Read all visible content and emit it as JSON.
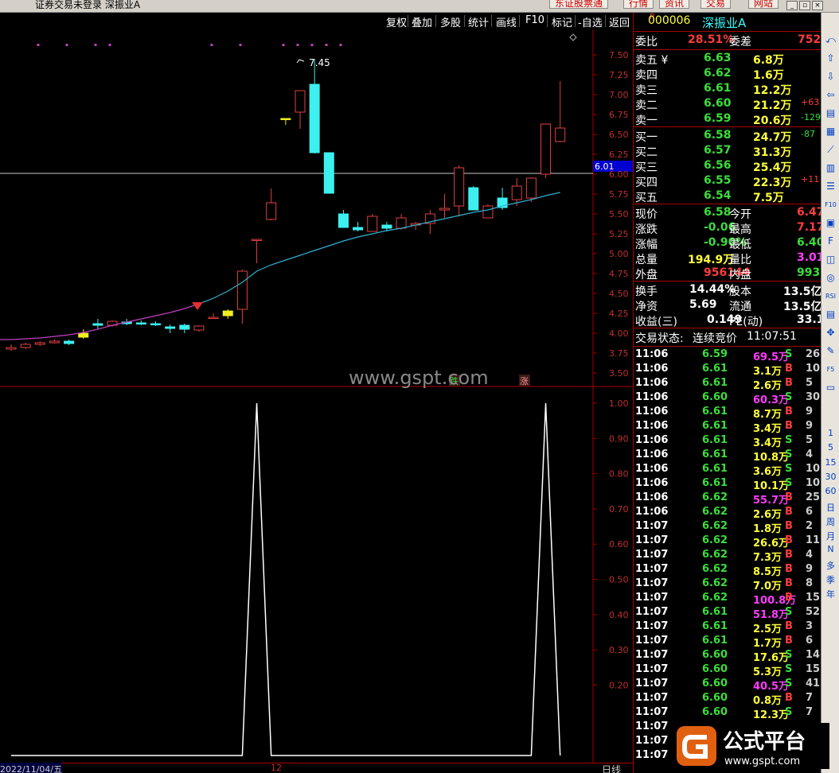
{
  "window": {
    "title": "证券交易未登录  深振业A",
    "top_buttons": [
      "东证股票通",
      "行情",
      "资讯",
      "交易",
      "网站"
    ],
    "win_controls": [
      "minimize-icon",
      "restore-icon",
      "close-icon"
    ]
  },
  "toolbar": {
    "items": [
      "复权",
      "叠加",
      "多股",
      "统计",
      "画线",
      "F10",
      "标记",
      "-自选",
      "返回"
    ]
  },
  "chart": {
    "price_label": "6.01",
    "high_label": "7.45",
    "watermark": "www.gspt.com",
    "down_tag": "跌",
    "up_tag": "涨",
    "date_label": "2022/11/04/五",
    "month_label": "12",
    "period_label": "日线",
    "colors": {
      "up": "#e04040",
      "down": "#3cf0f0",
      "ma": "#2fb0d0",
      "ma_old": "#c040c0",
      "yellow": "#f0f020",
      "indicator": "#ffffff"
    }
  },
  "chart_data": [
    {
      "type": "candlestick",
      "title": "",
      "ylim": [
        3.4,
        7.7
      ],
      "yticks": [
        "7.50",
        "7.25",
        "7.00",
        "6.75",
        "6.50",
        "6.25",
        "6.00",
        "5.75",
        "5.50",
        "5.25",
        "5.00",
        "4.75",
        "4.50",
        "4.25",
        "4.00",
        "3.75",
        "3.50"
      ],
      "ohlc": [
        [
          3.8,
          3.86,
          3.78,
          3.82
        ],
        [
          3.82,
          3.88,
          3.8,
          3.86
        ],
        [
          3.86,
          3.9,
          3.84,
          3.88
        ],
        [
          3.88,
          3.92,
          3.87,
          3.9
        ],
        [
          3.9,
          3.92,
          3.85,
          3.87
        ],
        [
          3.95,
          4.05,
          3.93,
          4.0
        ],
        [
          4.12,
          4.18,
          4.05,
          4.1
        ],
        [
          4.1,
          4.16,
          4.08,
          4.15
        ],
        [
          4.14,
          4.18,
          4.1,
          4.12
        ],
        [
          4.13,
          4.16,
          4.1,
          4.12
        ],
        [
          4.12,
          4.15,
          4.09,
          4.11
        ],
        [
          4.08,
          4.11,
          4.0,
          4.06
        ],
        [
          4.1,
          4.12,
          4.0,
          4.05
        ],
        [
          4.04,
          4.1,
          4.02,
          4.09
        ],
        [
          4.2,
          4.25,
          4.18,
          4.2
        ],
        [
          4.22,
          4.3,
          4.18,
          4.28
        ],
        [
          4.3,
          4.8,
          4.12,
          4.78
        ],
        [
          5.18,
          5.18,
          4.88,
          5.18
        ],
        [
          5.43,
          5.82,
          5.42,
          5.64
        ],
        [
          6.7,
          6.7,
          6.62,
          6.7
        ],
        [
          6.78,
          7.05,
          6.57,
          7.05
        ],
        [
          7.13,
          7.45,
          6.26,
          6.27
        ],
        [
          6.27,
          6.27,
          5.76,
          5.76
        ],
        [
          5.5,
          5.55,
          5.33,
          5.33
        ],
        [
          5.33,
          5.4,
          5.28,
          5.3
        ],
        [
          5.28,
          5.5,
          5.28,
          5.47
        ],
        [
          5.36,
          5.4,
          5.28,
          5.32
        ],
        [
          5.32,
          5.5,
          5.3,
          5.45
        ],
        [
          5.36,
          5.4,
          5.3,
          5.38
        ],
        [
          5.38,
          5.55,
          5.25,
          5.5
        ],
        [
          5.55,
          5.75,
          5.45,
          5.57
        ],
        [
          5.6,
          6.11,
          5.47,
          6.08
        ],
        [
          5.83,
          5.85,
          5.55,
          5.55
        ],
        [
          5.45,
          5.62,
          5.45,
          5.6
        ],
        [
          5.7,
          5.83,
          5.55,
          5.58
        ],
        [
          5.68,
          5.95,
          5.6,
          5.85
        ],
        [
          5.7,
          5.96,
          5.65,
          5.95
        ],
        [
          6.0,
          6.63,
          5.95,
          6.63
        ],
        [
          6.41,
          7.17,
          6.4,
          6.58
        ]
      ],
      "ma": [
        3.92,
        3.93,
        3.94,
        3.96,
        3.98,
        4.01,
        4.05,
        4.1,
        4.14,
        4.18,
        4.22,
        4.26,
        4.31,
        4.37,
        4.44,
        4.53,
        4.64,
        4.78,
        4.86,
        4.92,
        4.98,
        5.04,
        5.1,
        5.16,
        5.21,
        5.25,
        5.29,
        5.32,
        5.36,
        5.4,
        5.44,
        5.48,
        5.52,
        5.55,
        5.6,
        5.64,
        5.68,
        5.73,
        5.77
      ]
    },
    {
      "type": "line",
      "title": "",
      "ylim": [
        0.1,
        1.05
      ],
      "yticks": [
        "1.00",
        "0.90",
        "0.80",
        "0.70",
        "0.60",
        "0.50",
        "0.40",
        "0.30",
        "0.20"
      ],
      "values": [
        0,
        0,
        0,
        0,
        0,
        0,
        0,
        0,
        0,
        0,
        0,
        0,
        0,
        0,
        0,
        0,
        0,
        1,
        0,
        0,
        0,
        0,
        0,
        0,
        0,
        0,
        0,
        0,
        0,
        0,
        0,
        0,
        0,
        0,
        0,
        0,
        0,
        1,
        0
      ]
    }
  ],
  "quote": {
    "code_prefix": "R",
    "code": "000006",
    "name": "深振业A",
    "wei_bi_label": "委比",
    "wei_bi": "28.51%",
    "wei_cha_label": "委差",
    "wei_cha": "752",
    "asks": [
      {
        "label": "卖五",
        "mark": "¥",
        "price": "6.63",
        "vol": "6.8万",
        "chg": ""
      },
      {
        "label": "卖四",
        "mark": "",
        "price": "6.62",
        "vol": "1.6万",
        "chg": ""
      },
      {
        "label": "卖三",
        "mark": "",
        "price": "6.61",
        "vol": "12.2万",
        "chg": ""
      },
      {
        "label": "卖二",
        "mark": "",
        "price": "6.60",
        "vol": "21.2万",
        "chg": "+63"
      },
      {
        "label": "卖一",
        "mark": "",
        "price": "6.59",
        "vol": "20.6万",
        "chg": "-129"
      }
    ],
    "bids": [
      {
        "label": "买一",
        "price": "6.58",
        "vol": "24.7万",
        "chg": "-87"
      },
      {
        "label": "买二",
        "price": "6.57",
        "vol": "31.3万",
        "chg": ""
      },
      {
        "label": "买三",
        "price": "6.56",
        "vol": "25.4万",
        "chg": ""
      },
      {
        "label": "买四",
        "price": "6.55",
        "vol": "22.3万",
        "chg": "+11"
      },
      {
        "label": "买五",
        "price": "6.54",
        "vol": "7.5万",
        "chg": ""
      }
    ],
    "stats": [
      {
        "l1": "现价",
        "v1": "6.58",
        "l2": "今开",
        "v2": "6.47"
      },
      {
        "l1": "涨跌",
        "v1": "-0.06",
        "l2": "最高",
        "v2": "7.17"
      },
      {
        "l1": "涨幅",
        "v1": "-0.90%",
        "l2": "最低",
        "v2": "6.40"
      },
      {
        "l1": "总量",
        "v1": "194.9万",
        "l2": "量比",
        "v2": "3.01"
      },
      {
        "l1": "外盘",
        "v1": "956144",
        "l2": "内盘",
        "v2": "993264"
      }
    ],
    "stats2": [
      {
        "l1": "换手",
        "v1": "14.44%",
        "l2": "股本",
        "v2": "13.5亿"
      },
      {
        "l1": "净资",
        "v1": "5.69",
        "l2": "流通",
        "v2": "13.5亿"
      },
      {
        "l1": "收益(三)",
        "v1": "0.149",
        "l2": "PE(动)",
        "v2": "33.1"
      }
    ],
    "status_label": "交易状态:",
    "status": "连续竞价",
    "status_time": "11:07:51"
  },
  "ticks": [
    {
      "t": "11:06",
      "p": "6.59",
      "v": "69.5万",
      "s": "S",
      "n": "26",
      "big": true
    },
    {
      "t": "11:06",
      "p": "6.61",
      "v": "3.1万",
      "s": "B",
      "n": "10",
      "big": false
    },
    {
      "t": "11:06",
      "p": "6.61",
      "v": "2.6万",
      "s": "B",
      "n": "5",
      "big": false
    },
    {
      "t": "11:06",
      "p": "6.60",
      "v": "60.3万",
      "s": "S",
      "n": "30",
      "big": true
    },
    {
      "t": "11:06",
      "p": "6.61",
      "v": "8.7万",
      "s": "B",
      "n": "9",
      "big": false
    },
    {
      "t": "11:06",
      "p": "6.61",
      "v": "3.4万",
      "s": "B",
      "n": "9",
      "big": false
    },
    {
      "t": "11:06",
      "p": "6.61",
      "v": "3.4万",
      "s": "S",
      "n": "5",
      "big": false
    },
    {
      "t": "11:06",
      "p": "6.61",
      "v": "10.8万",
      "s": "S",
      "n": "4",
      "big": false
    },
    {
      "t": "11:06",
      "p": "6.61",
      "v": "3.6万",
      "s": "S",
      "n": "10",
      "big": false
    },
    {
      "t": "11:06",
      "p": "6.61",
      "v": "10.1万",
      "s": "S",
      "n": "10",
      "big": false
    },
    {
      "t": "11:06",
      "p": "6.62",
      "v": "55.7万",
      "s": "B",
      "n": "25",
      "big": true
    },
    {
      "t": "11:06",
      "p": "6.62",
      "v": "2.6万",
      "s": "B",
      "n": "6",
      "big": false
    },
    {
      "t": "11:07",
      "p": "6.62",
      "v": "1.8万",
      "s": "B",
      "n": "2",
      "big": false
    },
    {
      "t": "11:07",
      "p": "6.62",
      "v": "26.6万",
      "s": "B",
      "n": "11",
      "big": false
    },
    {
      "t": "11:07",
      "p": "6.62",
      "v": "7.3万",
      "s": "B",
      "n": "4",
      "big": false
    },
    {
      "t": "11:07",
      "p": "6.62",
      "v": "8.5万",
      "s": "B",
      "n": "9",
      "big": false
    },
    {
      "t": "11:07",
      "p": "6.62",
      "v": "7.0万",
      "s": "B",
      "n": "8",
      "big": false
    },
    {
      "t": "11:07",
      "p": "6.62",
      "v": "100.8万",
      "s": "B",
      "n": "15",
      "big": true
    },
    {
      "t": "11:07",
      "p": "6.61",
      "v": "51.8万",
      "s": "S",
      "n": "52",
      "big": true
    },
    {
      "t": "11:07",
      "p": "6.61",
      "v": "2.5万",
      "s": "B",
      "n": "3",
      "big": false
    },
    {
      "t": "11:07",
      "p": "6.61",
      "v": "1.7万",
      "s": "B",
      "n": "6",
      "big": false
    },
    {
      "t": "11:07",
      "p": "6.60",
      "v": "17.6万",
      "s": "S",
      "n": "14",
      "big": false
    },
    {
      "t": "11:07",
      "p": "6.60",
      "v": "5.3万",
      "s": "S",
      "n": "15",
      "big": false
    },
    {
      "t": "11:07",
      "p": "6.60",
      "v": "40.5万",
      "s": "S",
      "n": "41",
      "big": true
    },
    {
      "t": "11:07",
      "p": "6.60",
      "v": "0.8万",
      "s": "B",
      "n": "7",
      "big": false
    },
    {
      "t": "11:07",
      "p": "6.60",
      "v": "12.3万",
      "s": "S",
      "n": "7",
      "big": false
    },
    {
      "t": "11:07",
      "p": "",
      "v": "",
      "s": "",
      "n": "",
      "big": false
    },
    {
      "t": "11:07",
      "p": "",
      "v": "",
      "s": "",
      "n": "",
      "big": false
    },
    {
      "t": "11:07",
      "p": "",
      "v": "",
      "s": "",
      "n": "",
      "big": false
    }
  ],
  "side_strip": {
    "periods": [
      "1",
      "5",
      "15",
      "30",
      "60",
      "日",
      "周",
      "月",
      "N",
      "多",
      "季",
      "年"
    ],
    "icons": [
      "back-icon",
      "up-arrow-icon",
      "down-arrow-icon",
      "left-arrow-icon",
      "book-icon",
      "grid-icon",
      "line-chart-icon",
      "bar-chart-icon",
      "list-icon",
      "f10-icon",
      "chart-icon",
      "f-icon",
      "analysis-icon",
      "scan-icon",
      "rsi-icon",
      "book2-icon",
      "move-icon",
      "pen-icon",
      "f5-icon",
      "window-icon"
    ],
    "rsi_label": "RSI",
    "f10_label": "F10",
    "f5_label": "F5"
  },
  "brand": {
    "name": "公式平台",
    "url": "www.gspt.com"
  }
}
